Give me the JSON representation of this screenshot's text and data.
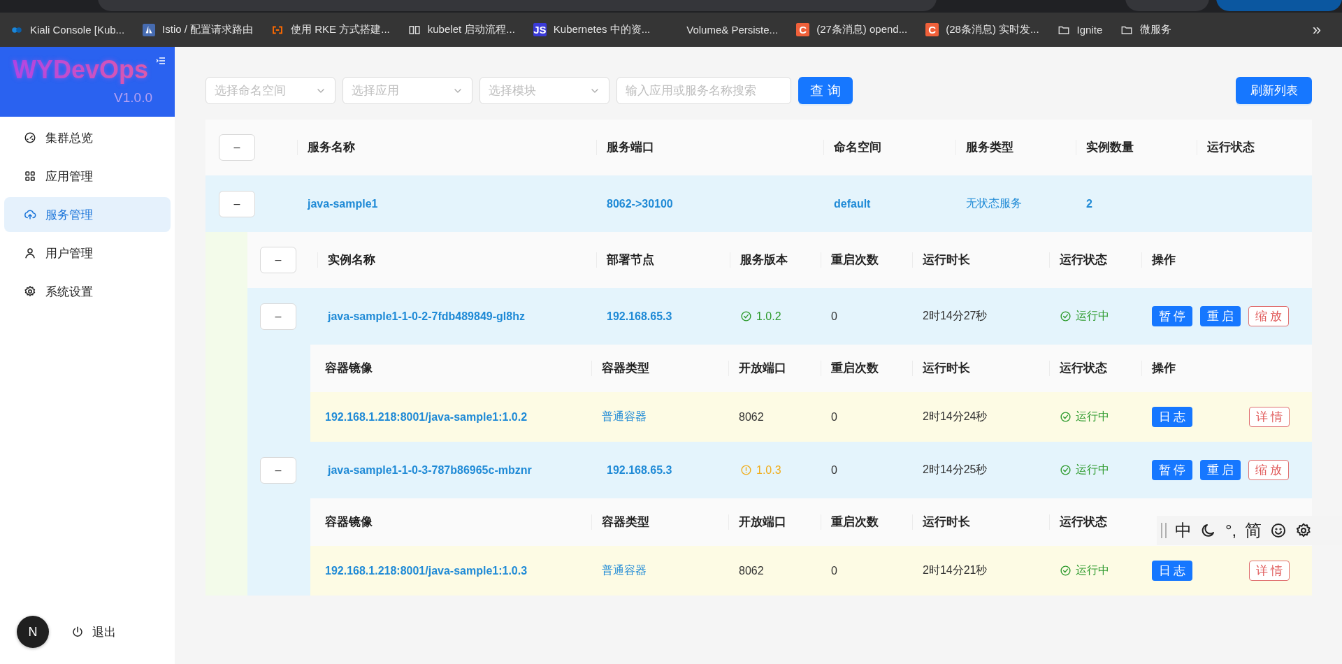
{
  "browser": {
    "bookmarks": [
      {
        "kind": "kiali",
        "label": "Kiali Console [Kub..."
      },
      {
        "kind": "sail",
        "label": "Istio / 配置请求路由"
      },
      {
        "kind": "bracket",
        "label": "使用 RKE 方式搭建..."
      },
      {
        "kind": "book",
        "label": "kubelet 启动流程..."
      },
      {
        "kind": "letter",
        "icon_text": "JS",
        "color": "#3a3ad8",
        "label": "Kubernetes 中的资..."
      },
      {
        "kind": "plain",
        "label": "Volume& Persiste..."
      },
      {
        "kind": "letter",
        "icon_text": "C",
        "color": "#f0603a",
        "label": "(27条消息) opend..."
      },
      {
        "kind": "letter",
        "icon_text": "C",
        "color": "#f0603a",
        "label": "(28条消息) 实时发..."
      },
      {
        "kind": "folder",
        "label": "Ignite"
      },
      {
        "kind": "folder",
        "label": "微服务"
      }
    ],
    "overflow": "»"
  },
  "sidebar": {
    "logo": "WYDevOps",
    "version": "V1.0.0",
    "menu": [
      {
        "kind": "dashboard",
        "label": "集群总览",
        "selected": false
      },
      {
        "kind": "apps",
        "label": "应用管理",
        "selected": false
      },
      {
        "kind": "cloud",
        "label": "服务管理",
        "selected": true
      },
      {
        "kind": "user",
        "label": "用户管理",
        "selected": false
      },
      {
        "kind": "gear",
        "label": "系统设置",
        "selected": false
      }
    ],
    "avatar": "N",
    "logout": "退出"
  },
  "filters": {
    "selects": [
      {
        "placeholder": "选择命名空间"
      },
      {
        "placeholder": "选择应用"
      },
      {
        "placeholder": "选择模块"
      }
    ],
    "search": {
      "placeholder": "输入应用或服务名称搜索"
    },
    "query_button": "查询",
    "refresh_button": "刷新列表"
  },
  "services": {
    "header_toggle": "–",
    "columns": [
      "服务名称",
      "服务端口",
      "命名空间",
      "服务类型",
      "实例数量",
      "运行状态"
    ],
    "rows": [
      {
        "toggle": "–",
        "expanded": true,
        "cells": [
          "java-sample1",
          "8062->30100",
          "default",
          "无状态服务",
          "2"
        ],
        "instances": {
          "header_toggle": "–",
          "columns": [
            "实例名称",
            "部署节点",
            "服务版本",
            "重启次数",
            "运行时长",
            "运行状态",
            "操作"
          ],
          "rows": [
            {
              "toggle": "–",
              "expanded": true,
              "name": "java-sample1-1-0-2-7fdb489849-gl8hz",
              "node": "192.168.65.3",
              "version": {
                "kind": "ok",
                "label": "1.0.2"
              },
              "restarts": "0",
              "uptime": "2时14分27秒",
              "state": {
                "kind": "running",
                "label": "运行中"
              },
              "actions": [
                {
                  "kind": "primary",
                  "label": "暂停"
                },
                {
                  "kind": "primary",
                  "label": "重启"
                },
                {
                  "kind": "danger",
                  "label": "缩放"
                }
              ],
              "containers": {
                "columns": [
                  "容器镜像",
                  "容器类型",
                  "开放端口",
                  "重启次数",
                  "运行时长",
                  "运行状态",
                  "操作"
                ],
                "rows": [
                  {
                    "image": "192.168.1.218:8001/java-sample1:1.0.2",
                    "type": "普通容器",
                    "ports": "8062",
                    "restarts": "0",
                    "uptime": "2时14分24秒",
                    "state": {
                      "kind": "running",
                      "label": "运行中"
                    },
                    "actions": [
                      {
                        "kind": "primary",
                        "label": "日志"
                      },
                      {
                        "kind": "danger",
                        "label": "详情"
                      }
                    ]
                  }
                ]
              }
            },
            {
              "toggle": "–",
              "expanded": true,
              "name": "java-sample1-1-0-3-787b86965c-mbznr",
              "node": "192.168.65.3",
              "version": {
                "kind": "warn",
                "label": "1.0.3"
              },
              "restarts": "0",
              "uptime": "2时14分25秒",
              "state": {
                "kind": "running",
                "label": "运行中"
              },
              "actions": [
                {
                  "kind": "primary",
                  "label": "暂停"
                },
                {
                  "kind": "primary",
                  "label": "重启"
                },
                {
                  "kind": "danger",
                  "label": "缩放"
                }
              ],
              "containers": {
                "columns": [
                  "容器镜像",
                  "容器类型",
                  "开放端口",
                  "重启次数",
                  "运行时长",
                  "运行状态"
                ],
                "rows": [
                  {
                    "image": "192.168.1.218:8001/java-sample1:1.0.3",
                    "type": "普通容器",
                    "ports": "8062",
                    "restarts": "0",
                    "uptime": "2时14分21秒",
                    "state": {
                      "kind": "running",
                      "label": "运行中"
                    },
                    "actions": [
                      {
                        "kind": "primary",
                        "label": "日志"
                      },
                      {
                        "kind": "danger",
                        "label": "详情"
                      }
                    ]
                  }
                ]
              }
            }
          ]
        }
      }
    ]
  },
  "ime_bar": [
    {
      "kind": "grip"
    },
    {
      "kind": "text",
      "label": "中"
    },
    {
      "kind": "moon"
    },
    {
      "kind": "text",
      "label": "°,"
    },
    {
      "kind": "text",
      "label": "简"
    },
    {
      "kind": "smiley"
    },
    {
      "kind": "gear"
    }
  ]
}
